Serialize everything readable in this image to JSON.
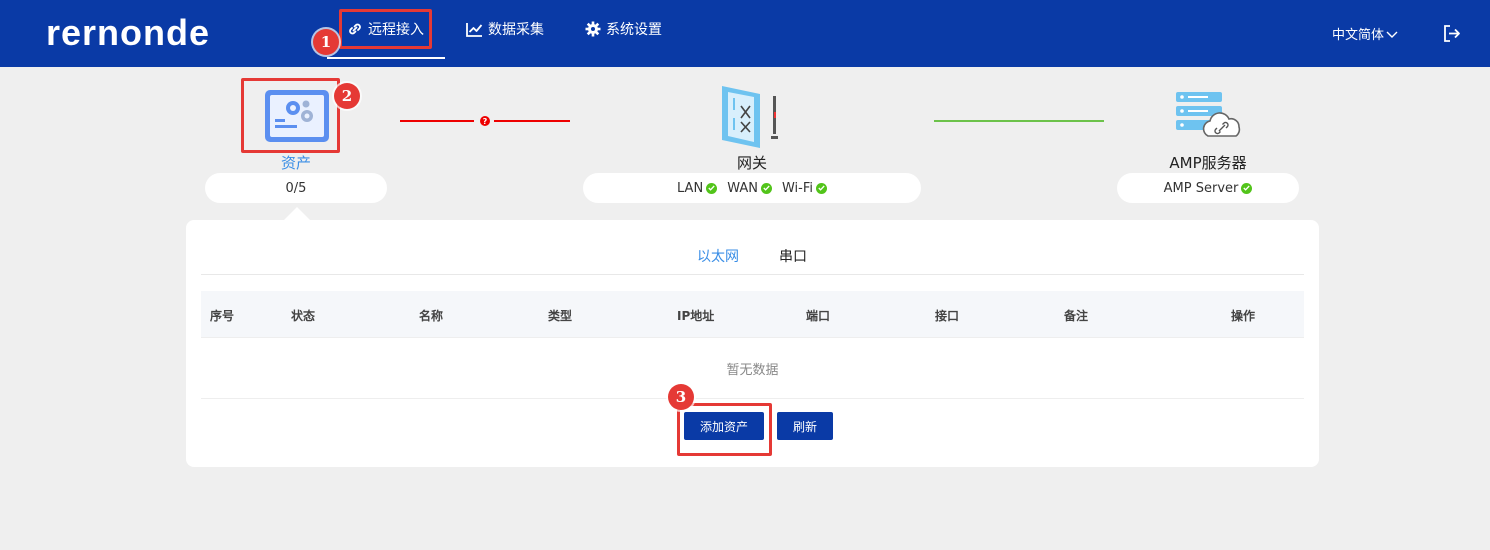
{
  "header": {
    "logo": "rernonde",
    "nav": [
      {
        "label": "远程接入",
        "icon": "link-icon",
        "active": true
      },
      {
        "label": "数据采集",
        "icon": "chart-line-icon",
        "active": false
      },
      {
        "label": "系统设置",
        "icon": "gear-icon",
        "active": false
      }
    ],
    "language": "中文简体",
    "logout_icon": "logout-icon"
  },
  "callouts": [
    "1",
    "2",
    "3"
  ],
  "topology": {
    "asset": {
      "label": "资产",
      "status": "0/5",
      "icon": "asset-config-icon"
    },
    "gateway": {
      "label": "网关",
      "icon": "gateway-icon",
      "statuses": [
        {
          "label": "LAN",
          "ok": true
        },
        {
          "label": "WAN",
          "ok": true
        },
        {
          "label": "Wi-Fi",
          "ok": true
        }
      ]
    },
    "server": {
      "label": "AMP服务器",
      "icon": "cloud-server-icon",
      "statuses": [
        {
          "label": "AMP Server",
          "ok": true
        }
      ]
    },
    "link_asset_gateway": {
      "state": "error",
      "color": "#e00000",
      "marker": "?"
    },
    "link_gateway_server": {
      "state": "ok",
      "color": "#6cc24a"
    }
  },
  "tabs": [
    {
      "label": "以太网",
      "active": true
    },
    {
      "label": "串口",
      "active": false
    }
  ],
  "table": {
    "columns": [
      "序号",
      "状态",
      "名称",
      "类型",
      "IP地址",
      "端口",
      "接口",
      "备注",
      "操作"
    ],
    "rows": [],
    "empty_text": "暂无数据"
  },
  "actions": {
    "add_asset": "添加资产",
    "refresh": "刷新"
  },
  "colors": {
    "brand": "#0a3aa6",
    "accent_blue": "#3a8ee6",
    "highlight": "#e53935",
    "ok": "#52c41a"
  }
}
